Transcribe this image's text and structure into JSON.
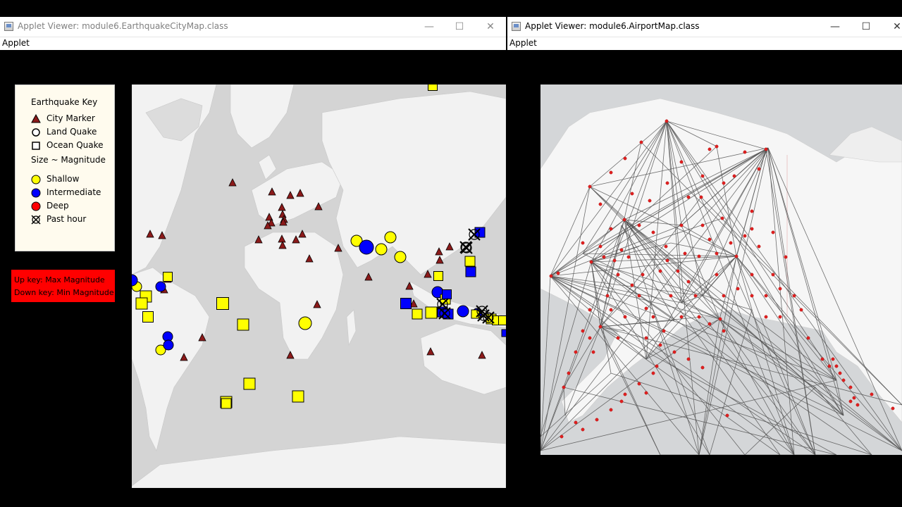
{
  "left_window": {
    "title": "Applet Viewer: module6.EarthquakeCityMap.class",
    "menu": "Applet",
    "key": {
      "title": "Earthquake Key",
      "items": [
        {
          "label": "City Marker",
          "icon": "triangle-icon"
        },
        {
          "label": "Land Quake",
          "icon": "circle-icon"
        },
        {
          "label": "Ocean Quake",
          "icon": "square-icon"
        }
      ],
      "size_label": "Size ~ Magnitude",
      "depth_items": [
        {
          "label": "Shallow",
          "color": "#ffff00"
        },
        {
          "label": "Intermediate",
          "color": "#0000ff"
        },
        {
          "label": "Deep",
          "color": "#ff0000"
        },
        {
          "label": "Past hour",
          "icon": "past-hour-icon"
        }
      ]
    },
    "magnitude_hint": {
      "up": "Up key: Max Magnitude",
      "down": "Down key: Min Magnitude"
    }
  },
  "right_window": {
    "title": "Applet Viewer: module6.AirportMap.class",
    "menu": "Applet"
  },
  "window_controls": {
    "minimize": "—",
    "maximize": "☐",
    "close": "✕"
  },
  "colors": {
    "city_marker": "#8b1a1a",
    "shallow": "#ffff00",
    "intermediate": "#0000ff",
    "deep": "#ff0000",
    "map_ocean": "#d4d4d4",
    "map_land": "#f2f2f2",
    "airport": "#e02020",
    "route": "#555555"
  }
}
